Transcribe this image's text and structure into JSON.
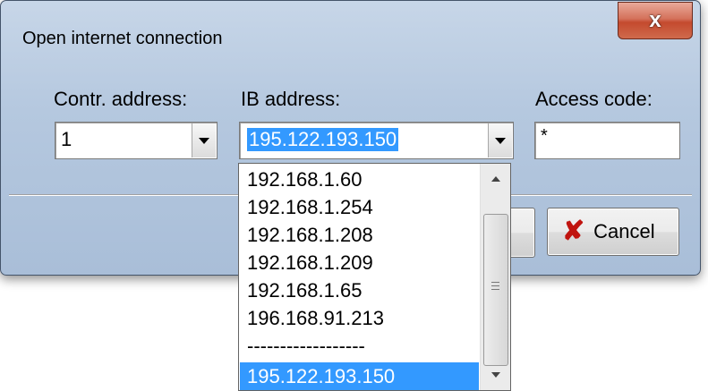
{
  "window": {
    "title": "Open internet connection",
    "close_glyph": "x"
  },
  "form": {
    "contr_label": "Contr. address:",
    "contr_value": "1",
    "ib_label": "IB address:",
    "ib_value": "195.122.193.150",
    "access_label": "Access code:",
    "access_value": "*"
  },
  "buttons": {
    "cancel_label": "Cancel",
    "cancel_icon": "red-x-icon"
  },
  "dropdown": {
    "items": [
      "192.168.1.60",
      "192.168.1.254",
      "192.168.1.208",
      "192.168.1.209",
      "192.168.1.65",
      "196.168.91.213",
      "------------------",
      "195.122.193.150"
    ],
    "selected_index": 7
  },
  "colors": {
    "selection": "#3399ff",
    "cancel_icon": "#c0140f",
    "close_button": "#c44a2e"
  }
}
